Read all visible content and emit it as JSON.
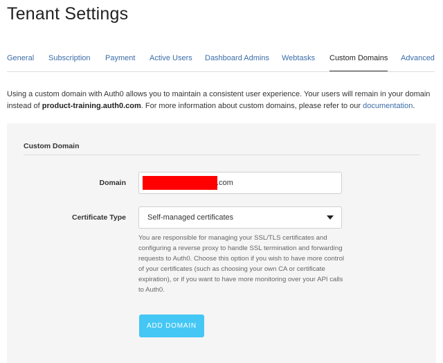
{
  "page": {
    "title": "Tenant Settings"
  },
  "tabs": [
    {
      "label": "General",
      "active": false
    },
    {
      "label": "Subscription",
      "active": false
    },
    {
      "label": "Payment",
      "active": false
    },
    {
      "label": "Active Users",
      "active": false
    },
    {
      "label": "Dashboard Admins",
      "active": false
    },
    {
      "label": "Webtasks",
      "active": false
    },
    {
      "label": "Custom Domains",
      "active": true
    },
    {
      "label": "Advanced",
      "active": false
    }
  ],
  "intro": {
    "text_before": "Using a custom domain with Auth0 allows you to maintain a consistent user experience. Your users will remain in your domain instead of",
    "tenant_domain": "product-training.auth0.com",
    "text_after": ". For more information about custom domains, please refer to our",
    "link_label": "documentation",
    "text_end": "."
  },
  "section": {
    "title": "Custom Domain",
    "domain": {
      "label": "Domain",
      "value_suffix": ".com"
    },
    "certificate": {
      "label": "Certificate Type",
      "selected": "Self-managed certificates",
      "help": "You are responsible for managing your SSL/TLS certificates and configuring a reverse proxy to handle SSL termination and forwarding requests to Auth0. Choose this option if you wish to have more control of your certificates (such as choosing your own CA or certificate expiration), or if you want to have more monitoring over your API calls to Auth0."
    },
    "add_button": "ADD DOMAIN"
  },
  "colors": {
    "link": "#3b6ca8",
    "button": "#44c7f4",
    "panel_bg": "#f5f5f5",
    "redaction": "#ff0000"
  }
}
